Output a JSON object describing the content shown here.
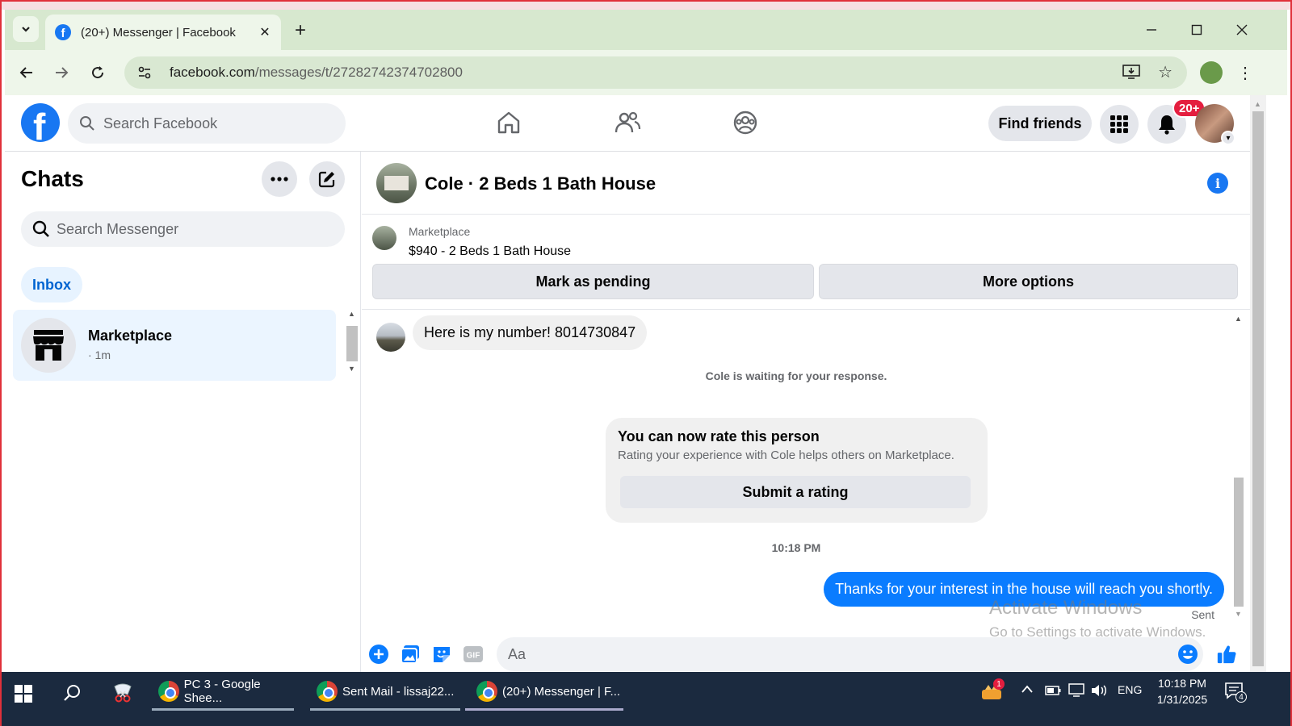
{
  "browser": {
    "tab_title": "(20+) Messenger | Facebook",
    "url_host": "facebook.com",
    "url_path": "/messages/t/27282742374702800"
  },
  "fb_header": {
    "search_placeholder": "Search Facebook",
    "find_friends_label": "Find friends",
    "notification_badge": "20+"
  },
  "sidebar": {
    "title": "Chats",
    "search_placeholder": "Search Messenger",
    "filter_chip": "Inbox",
    "chats": [
      {
        "name": "Marketplace",
        "time": "· 1m"
      }
    ]
  },
  "conversation": {
    "title": "Cole · 2 Beds 1 Bath House",
    "listing": {
      "source": "Marketplace",
      "title": "$940 - 2 Beds 1 Bath House",
      "primary_action": "Mark as pending",
      "secondary_action": "More options"
    },
    "incoming_message": "Here is my number! 8014730847",
    "waiting_note": "Cole is waiting for your response.",
    "rating_card": {
      "title": "You can now rate this person",
      "subtitle": "Rating your experience with Cole helps others on Marketplace.",
      "button": "Submit a rating"
    },
    "timestamp": "10:18 PM",
    "outgoing_message": "Thanks for your interest in the house will reach you shortly.",
    "outgoing_status": "Sent",
    "composer_placeholder": "Aa"
  },
  "watermark": {
    "title": "Activate Windows",
    "subtitle": "Go to Settings to activate Windows."
  },
  "taskbar": {
    "apps": [
      {
        "label": "PC 3 - Google Shee..."
      },
      {
        "label": "Sent Mail - lissaj22..."
      },
      {
        "label": "(20+) Messenger | F..."
      }
    ],
    "language": "ENG",
    "time": "10:18 PM",
    "date": "1/31/2025",
    "notification_count": "4",
    "tray_badge": "1"
  },
  "colors": {
    "facebook_blue": "#1877f2",
    "messenger_bubble": "#0a7cff",
    "notification_red": "#e41e3f",
    "chrome_tabbar": "#d7e8cf"
  }
}
